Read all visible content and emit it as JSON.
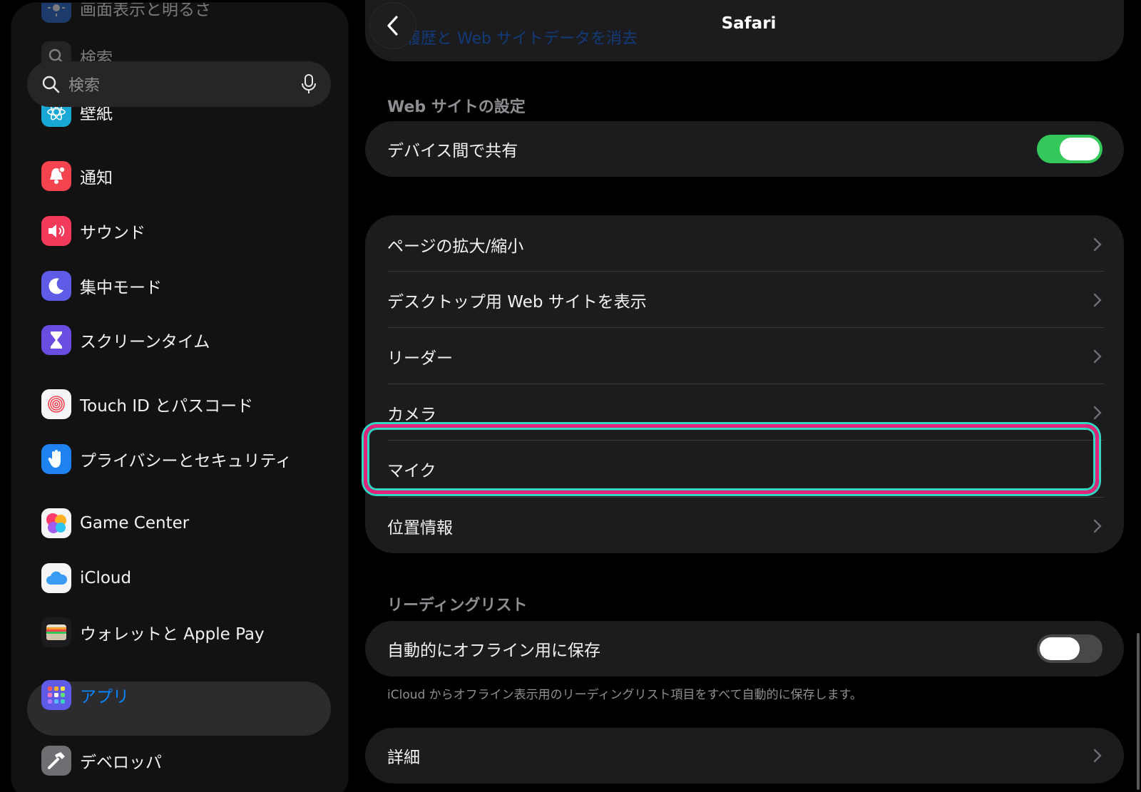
{
  "sidebar": {
    "search_placeholder": "検索",
    "items": [
      {
        "label": "画面表示と明るさ"
      },
      {
        "label": "検索"
      },
      {
        "label": "壁紙"
      },
      {
        "label": "通知"
      },
      {
        "label": "サウンド"
      },
      {
        "label": "集中モード"
      },
      {
        "label": "スクリーンタイム"
      },
      {
        "label": "Touch ID とパスコード"
      },
      {
        "label": "プライバシーとセキュリティ"
      },
      {
        "label": "Game Center"
      },
      {
        "label": "iCloud"
      },
      {
        "label": "ウォレットと Apple Pay"
      },
      {
        "label": "アプリ",
        "selected": true
      },
      {
        "label": "デベロッパ"
      }
    ],
    "selected_color": "#0a84ff"
  },
  "nav": {
    "title": "Safari",
    "faded_link": "履歴と Web サイトデータを消去"
  },
  "sections": {
    "website_settings_header": "Web サイトの設定",
    "share_across_devices": {
      "label": "デバイス間で共有",
      "on": true
    },
    "site_rows": [
      {
        "label": "ページの拡大/縮小"
      },
      {
        "label": "デスクトップ用 Web サイトを表示"
      },
      {
        "label": "リーダー"
      },
      {
        "label": "カメラ"
      },
      {
        "label": "マイク",
        "highlighted": true
      },
      {
        "label": "位置情報"
      }
    ],
    "reading_list_header": "リーディングリスト",
    "auto_save_offline": {
      "label": "自動的にオフライン用に保存",
      "on": false
    },
    "reading_list_footnote": "iCloud からオフライン表示用のリーディングリスト項目をすべて自動的に保存します。",
    "advanced": {
      "label": "詳細"
    }
  },
  "colors": {
    "toggle_on": "#34c759",
    "highlight_outer": "#e0247a",
    "highlight_inner": "#33d6c3"
  }
}
